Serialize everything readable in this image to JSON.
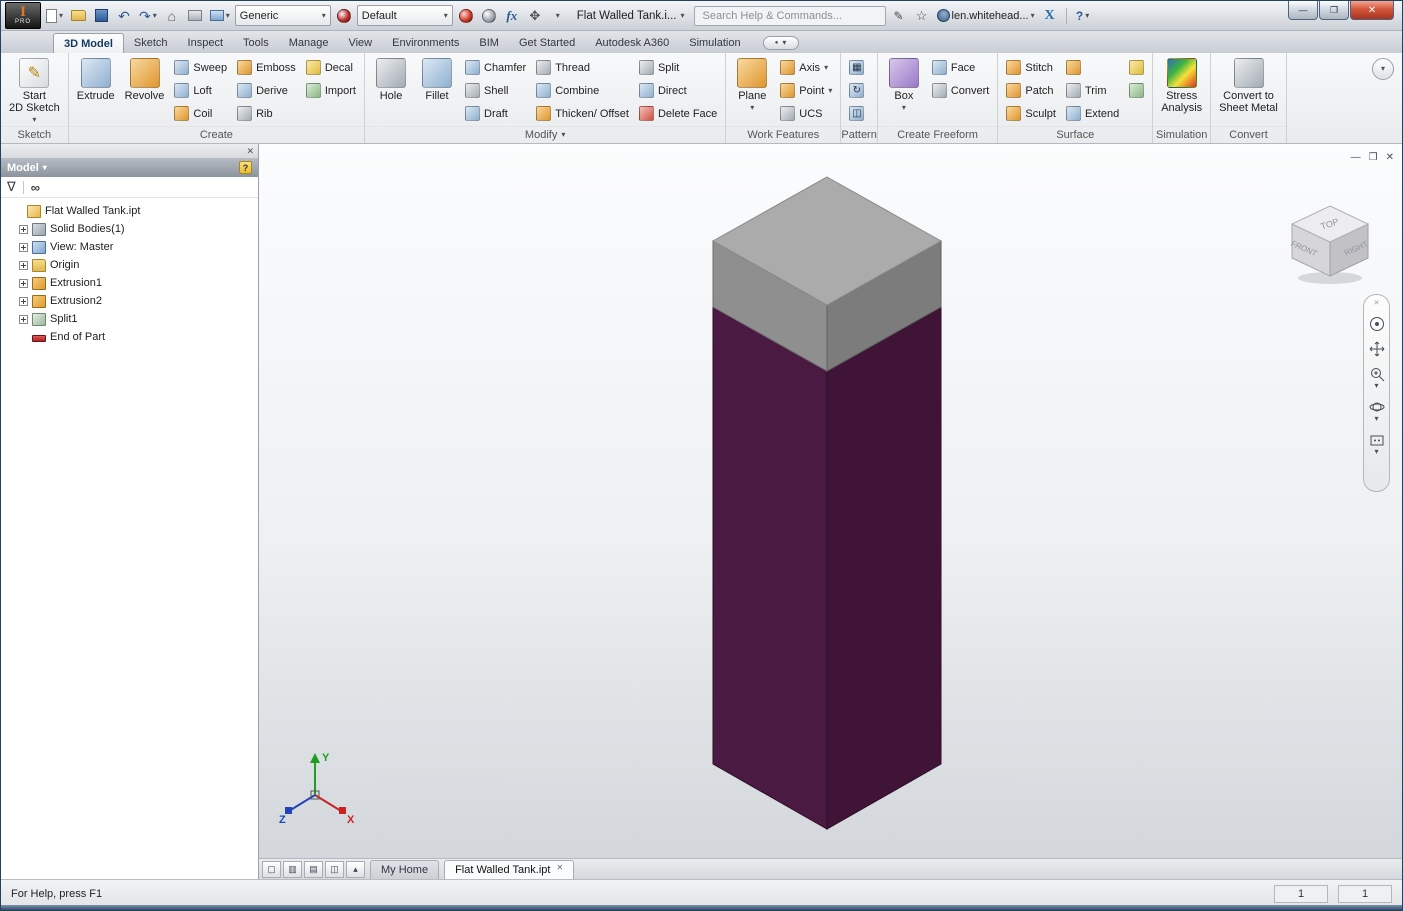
{
  "glyphs": {
    "caret_down": "▾",
    "caret_up": "▴",
    "close": "✕",
    "minimize": "—",
    "restore": "❐",
    "maximize": "▢",
    "undo": "↶",
    "redo": "↷",
    "home": "⌂",
    "star": "☆",
    "question": "?",
    "exchange_x": "X",
    "fx": "fx",
    "pencil": "✎",
    "move": "✥",
    "funnel": "∇",
    "binoculars": "∞",
    "pattern_rect": "▦",
    "pattern_circular": "↻",
    "pattern_mirror": "◫",
    "layout_1": "▢",
    "layout_2": "▥",
    "layout_3": "▤",
    "layout_4": "◫",
    "dot": "●"
  },
  "titlebar": {
    "app_letter": "I",
    "app_badge": "PRO",
    "material": "Generic",
    "appearance": "Default",
    "doc_title": "Flat Walled Tank.i...",
    "search_placeholder": "Search Help & Commands...",
    "user": "len.whitehead..."
  },
  "ribbon_tabs": {
    "active": "3D Model",
    "items": [
      "3D Model",
      "Sketch",
      "Inspect",
      "Tools",
      "Manage",
      "View",
      "Environments",
      "BIM",
      "Get Started",
      "Autodesk A360",
      "Simulation"
    ]
  },
  "panels": {
    "sketch": {
      "label": "Sketch",
      "start_line1": "Start",
      "start_line2": "2D Sketch"
    },
    "create": {
      "label": "Create",
      "big": [
        "Extrude",
        "Revolve"
      ],
      "col1": [
        "Sweep",
        "Loft",
        "Coil"
      ],
      "col2": [
        "Emboss",
        "Derive",
        "Rib"
      ],
      "col3": [
        "Decal",
        "Import"
      ]
    },
    "modify": {
      "label": "Modify",
      "big": [
        "Hole",
        "Fillet"
      ],
      "col1": [
        "Chamfer",
        "Shell",
        "Draft"
      ],
      "col2": [
        "Thread",
        "Combine",
        "Thicken/ Offset"
      ],
      "col3": [
        "Split",
        "Direct",
        "Delete Face"
      ]
    },
    "work_features": {
      "label": "Work Features",
      "big": "Plane",
      "col": [
        "Axis",
        "Point",
        "UCS"
      ]
    },
    "pattern": {
      "label": "Pattern"
    },
    "freeform": {
      "label": "Create Freeform",
      "big": "Box",
      "col": [
        "Face",
        "Convert"
      ]
    },
    "surface": {
      "label": "Surface",
      "col1": [
        "Stitch",
        "Patch",
        "Sculpt"
      ],
      "col2": [
        "Trim",
        "Extend"
      ]
    },
    "simulation": {
      "label": "Simulation",
      "big_line1": "Stress",
      "big_line2": "Analysis"
    },
    "convert": {
      "label": "Convert",
      "big_line1": "Convert to",
      "big_line2": "Sheet Metal"
    }
  },
  "browser": {
    "title": "Model",
    "help_label": "?",
    "tree": [
      {
        "label": "Flat Walled Tank.ipt"
      },
      {
        "label": "Solid Bodies(1)"
      },
      {
        "label": "View: Master"
      },
      {
        "label": "Origin"
      },
      {
        "label": "Extrusion1"
      },
      {
        "label": "Extrusion2"
      },
      {
        "label": "Split1"
      },
      {
        "label": "End of Part"
      }
    ]
  },
  "viewport": {
    "viewcube": {
      "top": "TOP",
      "front": "FRONT",
      "right": "RIGHT"
    },
    "triad": {
      "x": "X",
      "y": "Y",
      "z": "Z"
    },
    "part_colors": {
      "cap_top": "#ababab",
      "cap_left": "#8f8f8f",
      "cap_right": "#7c7c7c",
      "body_left": "#4b1a42",
      "body_right": "#3f1437"
    }
  },
  "doc_tabs": {
    "items": [
      "My Home",
      "Flat Walled Tank.ipt"
    ],
    "active": "Flat Walled Tank.ipt"
  },
  "statusbar": {
    "help_text": "For Help, press F1",
    "field1": "1",
    "field2": "1"
  }
}
